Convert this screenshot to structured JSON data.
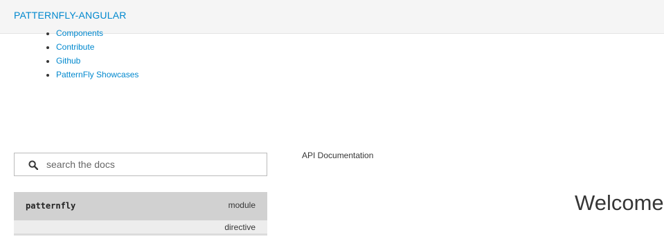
{
  "header": {
    "brand": "PATTERNFLY-ANGULAR"
  },
  "nav": {
    "items": [
      {
        "label": "Components"
      },
      {
        "label": "Contribute"
      },
      {
        "label": "Github"
      },
      {
        "label": "PatternFly Showcases"
      }
    ]
  },
  "search": {
    "icon": "search-icon",
    "placeholder": "search the docs",
    "value": ""
  },
  "docs": {
    "items": [
      {
        "name": "patternfly",
        "type": "module"
      },
      {
        "name": "",
        "type": "directive"
      }
    ]
  },
  "main": {
    "breadcrumb": "API Documentation",
    "title": "Welcome"
  },
  "colors": {
    "link": "#0088ce",
    "header_bg": "#f5f5f5",
    "selected_row": "#d1d1d1"
  }
}
